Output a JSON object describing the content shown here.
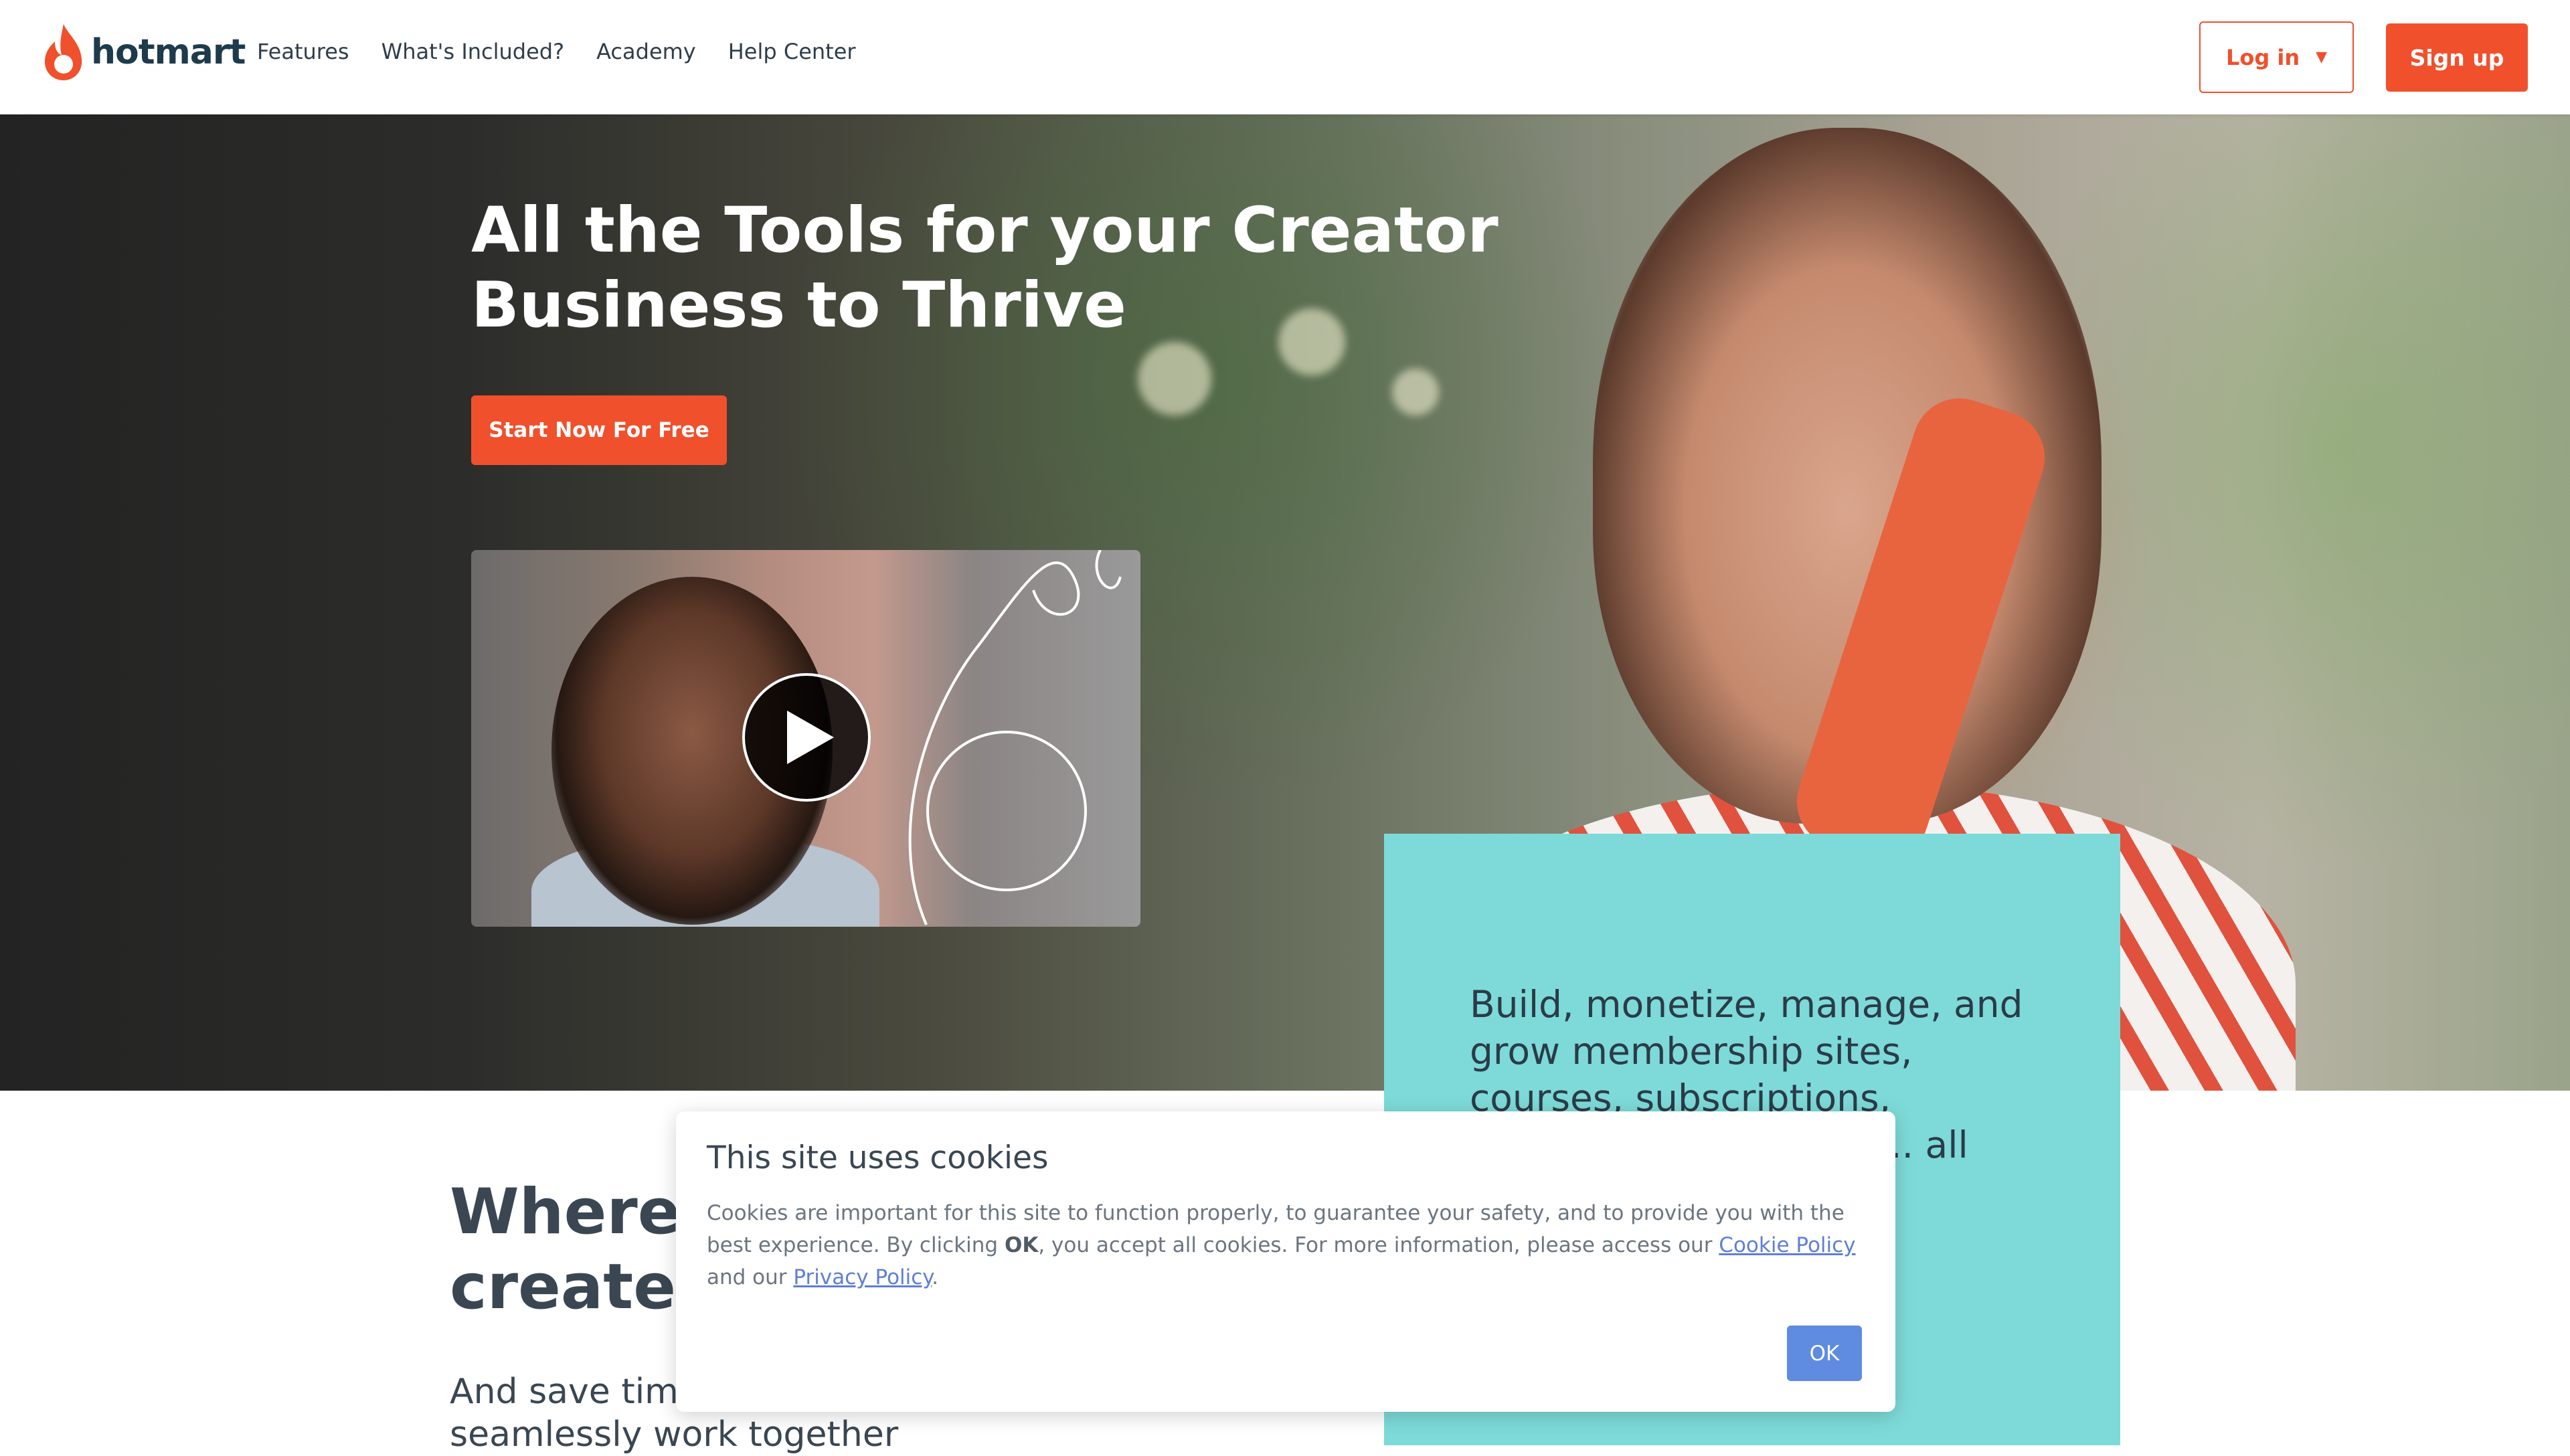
{
  "header": {
    "logo_text": "hotmart",
    "nav": [
      "Features",
      "What's Included?",
      "Academy",
      "Help Center"
    ],
    "login_label": "Log in",
    "signup_label": "Sign up"
  },
  "hero": {
    "title": "All the Tools for your Creator Business to Thrive",
    "cta_label": "Start Now For Free",
    "teal_text": "Build, monetize, manage, and grow membership sites, courses, subscriptions, communities, events, ... all from your"
  },
  "section": {
    "title": "Where creators create",
    "subtitle": "And save time by having all your tools seamlessly work together"
  },
  "cookie": {
    "title": "This site uses cookies",
    "body_1": "Cookies are important for this site to function properly, to guarantee your safety, and to provide you with the best experience. By clicking ",
    "body_ok": "OK",
    "body_2": ", you accept all cookies. For more information, please access our ",
    "cookie_policy_link": "Cookie Policy",
    "body_3": " and our ",
    "privacy_policy_link": "Privacy Policy",
    "body_4": ".",
    "ok_label": "OK"
  },
  "colors": {
    "brand_orange": "#f0502c",
    "teal": "#7ddad8",
    "link_blue": "#5f7fd6"
  },
  "icons": [
    "hotmart-flame-logo",
    "caret-down-icon",
    "play-icon"
  ]
}
